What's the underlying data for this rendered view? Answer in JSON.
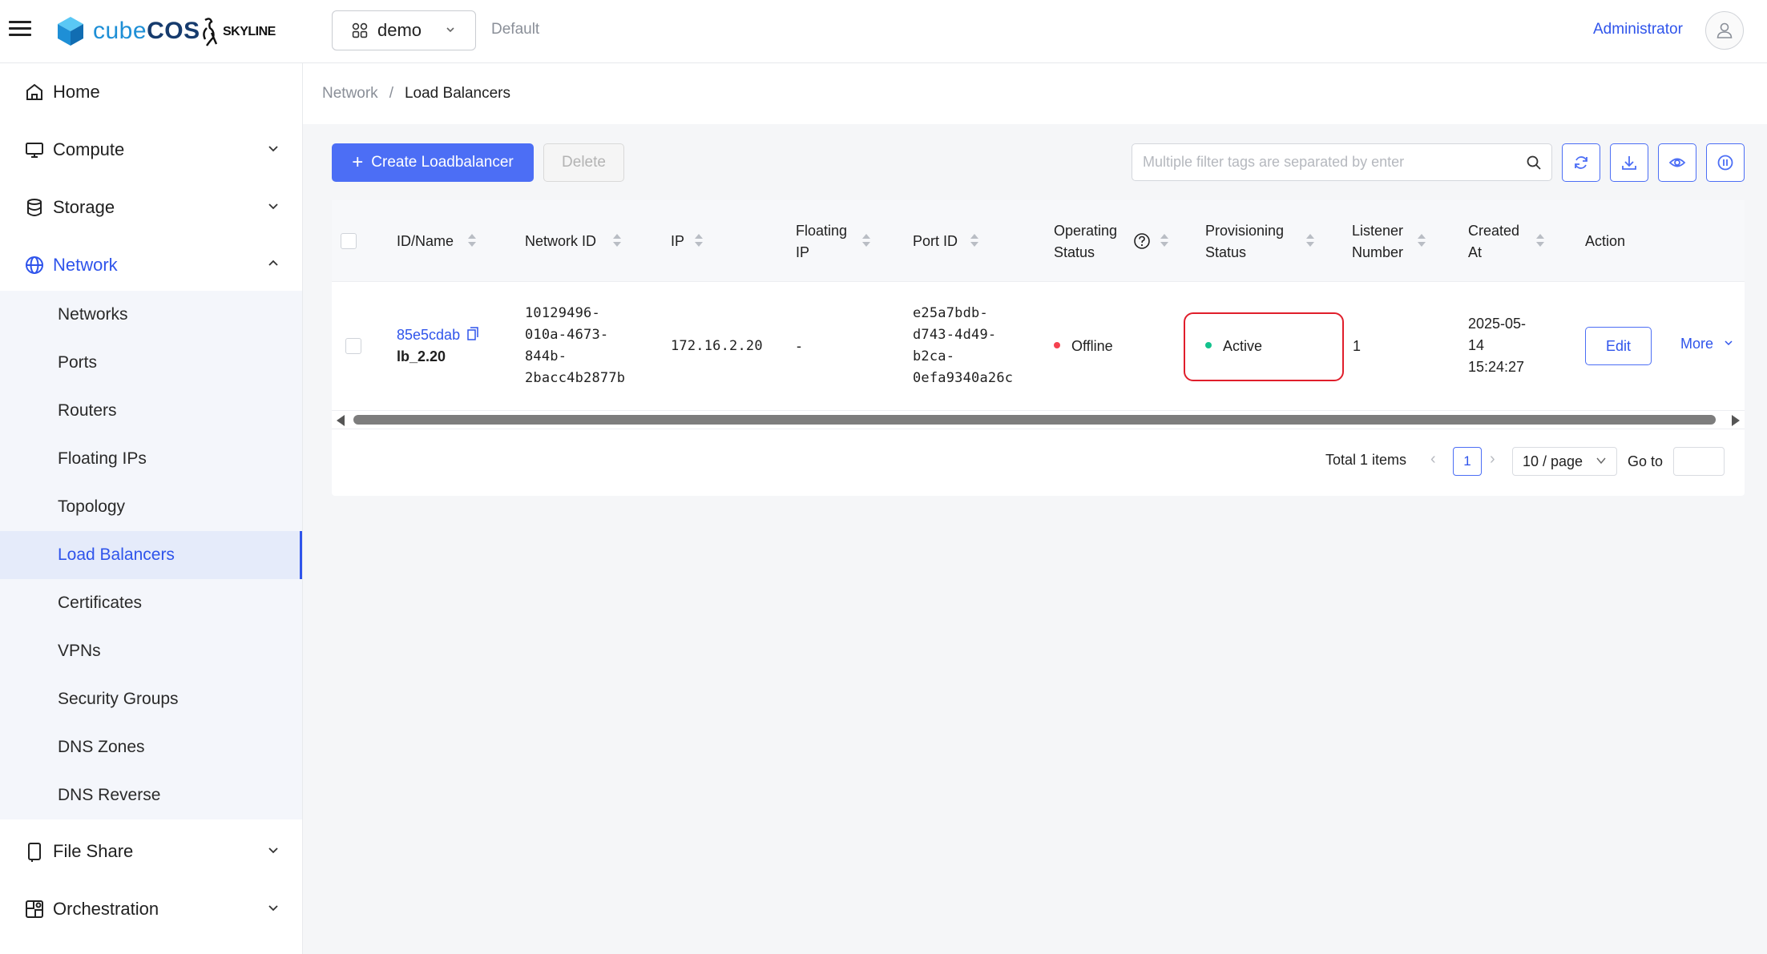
{
  "header": {
    "brand_prefix": "cube",
    "brand_suffix": "COS",
    "partner_logo": "SKYLINE",
    "project": "demo",
    "domain": "Default",
    "user": "Administrator",
    "icons": [
      "hamburger-icon",
      "cube-logo-icon",
      "skyline-logo-icon",
      "project-grid-icon",
      "chevron-down-icon",
      "user-icon"
    ]
  },
  "sidebar": {
    "items": [
      {
        "label": "Home",
        "icon": "home-icon"
      },
      {
        "label": "Compute",
        "icon": "monitor-icon"
      },
      {
        "label": "Storage",
        "icon": "database-icon"
      },
      {
        "label": "Network",
        "icon": "globe-icon"
      },
      {
        "label": "File Share",
        "icon": "file-share-icon"
      },
      {
        "label": "Orchestration",
        "icon": "orchestration-icon"
      }
    ],
    "network_sub": [
      "Networks",
      "Ports",
      "Routers",
      "Floating IPs",
      "Topology",
      "Load Balancers",
      "Certificates",
      "VPNs",
      "Security Groups",
      "DNS Zones",
      "DNS Reverse"
    ]
  },
  "breadcrumb": {
    "parent": "Network",
    "separator": "/",
    "current": "Load Balancers"
  },
  "toolbar": {
    "create_label": "Create Loadbalancer",
    "delete_label": "Delete",
    "search_placeholder": "Multiple filter tags are separated by enter",
    "icons": [
      "search-icon",
      "refresh-icon",
      "download-icon",
      "eye-icon",
      "pause-icon"
    ]
  },
  "table": {
    "columns": {
      "id_name": "ID/Name",
      "network_id": "Network ID",
      "ip": "IP",
      "floating_ip_1": "Floating",
      "floating_ip_2": "IP",
      "port_id": "Port ID",
      "operating_1": "Operating",
      "operating_2": "Status",
      "provisioning_1": "Provisioning",
      "provisioning_2": "Status",
      "listener_1": "Listener",
      "listener_2": "Number",
      "created_1": "Created",
      "created_2": "At",
      "action": "Action"
    },
    "rows": [
      {
        "id": "85e5cdab",
        "name": "lb_2.20",
        "network_id": [
          "10129496-",
          "010a-4673-",
          "844b-",
          "2bacc4b2877b"
        ],
        "ip": "172.16.2.20",
        "floating_ip": "-",
        "port_id": [
          "e25a7bdb-",
          "d743-4d49-",
          "b2ca-",
          "0efa9340a26c"
        ],
        "operating_status": "Offline",
        "provisioning_status": "Active",
        "listener_number": "1",
        "created_at": [
          "2025-05-",
          "14",
          "15:24:27"
        ],
        "edit_label": "Edit",
        "more_label": "More"
      }
    ],
    "colors": {
      "offline": "#f5414f",
      "active": "#13c28d",
      "accent": "#2f54eb",
      "highlight": "#e01e2b"
    }
  },
  "pagination": {
    "total": "Total 1 items",
    "current_page": "1",
    "page_size": "10 / page",
    "goto_label": "Go to"
  }
}
